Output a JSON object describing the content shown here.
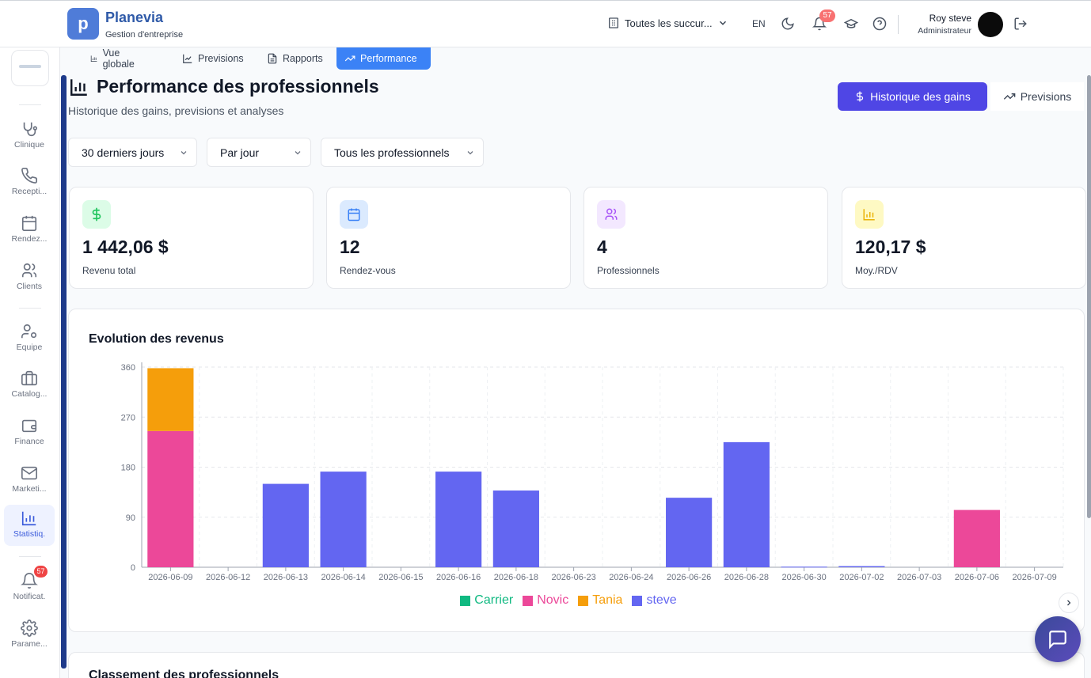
{
  "app": {
    "brand": "Planevia",
    "brand_sub": "Gestion d'entreprise",
    "logo_letter": "p"
  },
  "topbar": {
    "branch": "Toutes les succur...",
    "lang": "EN",
    "notif_count": "57",
    "user_name": "Roy steve",
    "user_role": "Administrateur"
  },
  "sidebar": {
    "items": [
      {
        "label": "Clinique",
        "icon": "stethoscope-icon"
      },
      {
        "label": "Recepti...",
        "icon": "phone-icon"
      },
      {
        "label": "Rendez...",
        "icon": "calendar-icon"
      },
      {
        "label": "Clients",
        "icon": "users-icon"
      },
      {
        "label": "Equipe",
        "icon": "user-cog-icon"
      },
      {
        "label": "Catalog...",
        "icon": "briefcase-icon"
      },
      {
        "label": "Finance",
        "icon": "wallet-icon"
      },
      {
        "label": "Marketi...",
        "icon": "mail-icon"
      },
      {
        "label": "Statistiq.",
        "icon": "bar-chart-icon"
      },
      {
        "label": "Notificat.",
        "icon": "bell-icon",
        "badge": "57"
      },
      {
        "label": "Parame...",
        "icon": "gear-icon"
      }
    ]
  },
  "tabs": [
    {
      "label": "Vue globale"
    },
    {
      "label": "Previsions"
    },
    {
      "label": "Rapports"
    },
    {
      "label": "Performance"
    }
  ],
  "header": {
    "title": "Performance des professionnels",
    "subtitle": "Historique des gains, previsions et analyses",
    "primary_button": "Historique des gains",
    "secondary_button": "Previsions"
  },
  "filters": {
    "period": "30 derniers jours",
    "granularity": "Par jour",
    "professional": "Tous les professionnels"
  },
  "kpis": [
    {
      "value": "1 442,06 $",
      "label": "Revenu total",
      "icon": "dollar-icon",
      "color": "#22c55e"
    },
    {
      "value": "12",
      "label": "Rendez-vous",
      "icon": "calendar-icon",
      "color": "#3b82f6"
    },
    {
      "value": "4",
      "label": "Professionnels",
      "icon": "users-icon",
      "color": "#a855f7"
    },
    {
      "value": "120,17 $",
      "label": "Moy./RDV",
      "icon": "bar-chart-icon",
      "color": "#eab308"
    }
  ],
  "chart_data": {
    "type": "bar",
    "stacked": true,
    "title": "Evolution des revenus",
    "categories": [
      "2026-06-09",
      "2026-06-12",
      "2026-06-13",
      "2026-06-14",
      "2026-06-15",
      "2026-06-16",
      "2026-06-18",
      "2026-06-23",
      "2026-06-24",
      "2026-06-26",
      "2026-06-28",
      "2026-06-30",
      "2026-07-02",
      "2026-07-03",
      "2026-07-06",
      "2026-07-09"
    ],
    "ylim": [
      0,
      360
    ],
    "yticks": [
      0,
      90,
      180,
      270,
      360
    ],
    "grid": true,
    "legend": "bottom",
    "series": [
      {
        "name": "Carrier",
        "color": "#10b981",
        "values": [
          0,
          0,
          0,
          0,
          0,
          0,
          0,
          0,
          0,
          0,
          0,
          0,
          0,
          0,
          0,
          0
        ]
      },
      {
        "name": "Novic",
        "color": "#ec4899",
        "values": [
          245,
          0,
          0,
          0,
          0,
          0,
          0,
          0,
          0,
          0,
          0,
          0,
          0,
          0,
          103,
          0
        ]
      },
      {
        "name": "Tania",
        "color": "#f59e0b",
        "values": [
          113,
          0,
          0,
          0,
          0,
          0,
          0,
          0,
          0,
          0,
          0,
          0,
          0,
          0,
          0,
          0
        ]
      },
      {
        "name": "steve",
        "color": "#6366f1",
        "values": [
          0,
          0,
          150,
          172,
          0,
          172,
          138,
          0,
          0,
          125,
          225,
          1,
          2,
          0,
          0,
          0
        ]
      }
    ]
  },
  "ranking": {
    "title": "Classement des professionnels"
  }
}
